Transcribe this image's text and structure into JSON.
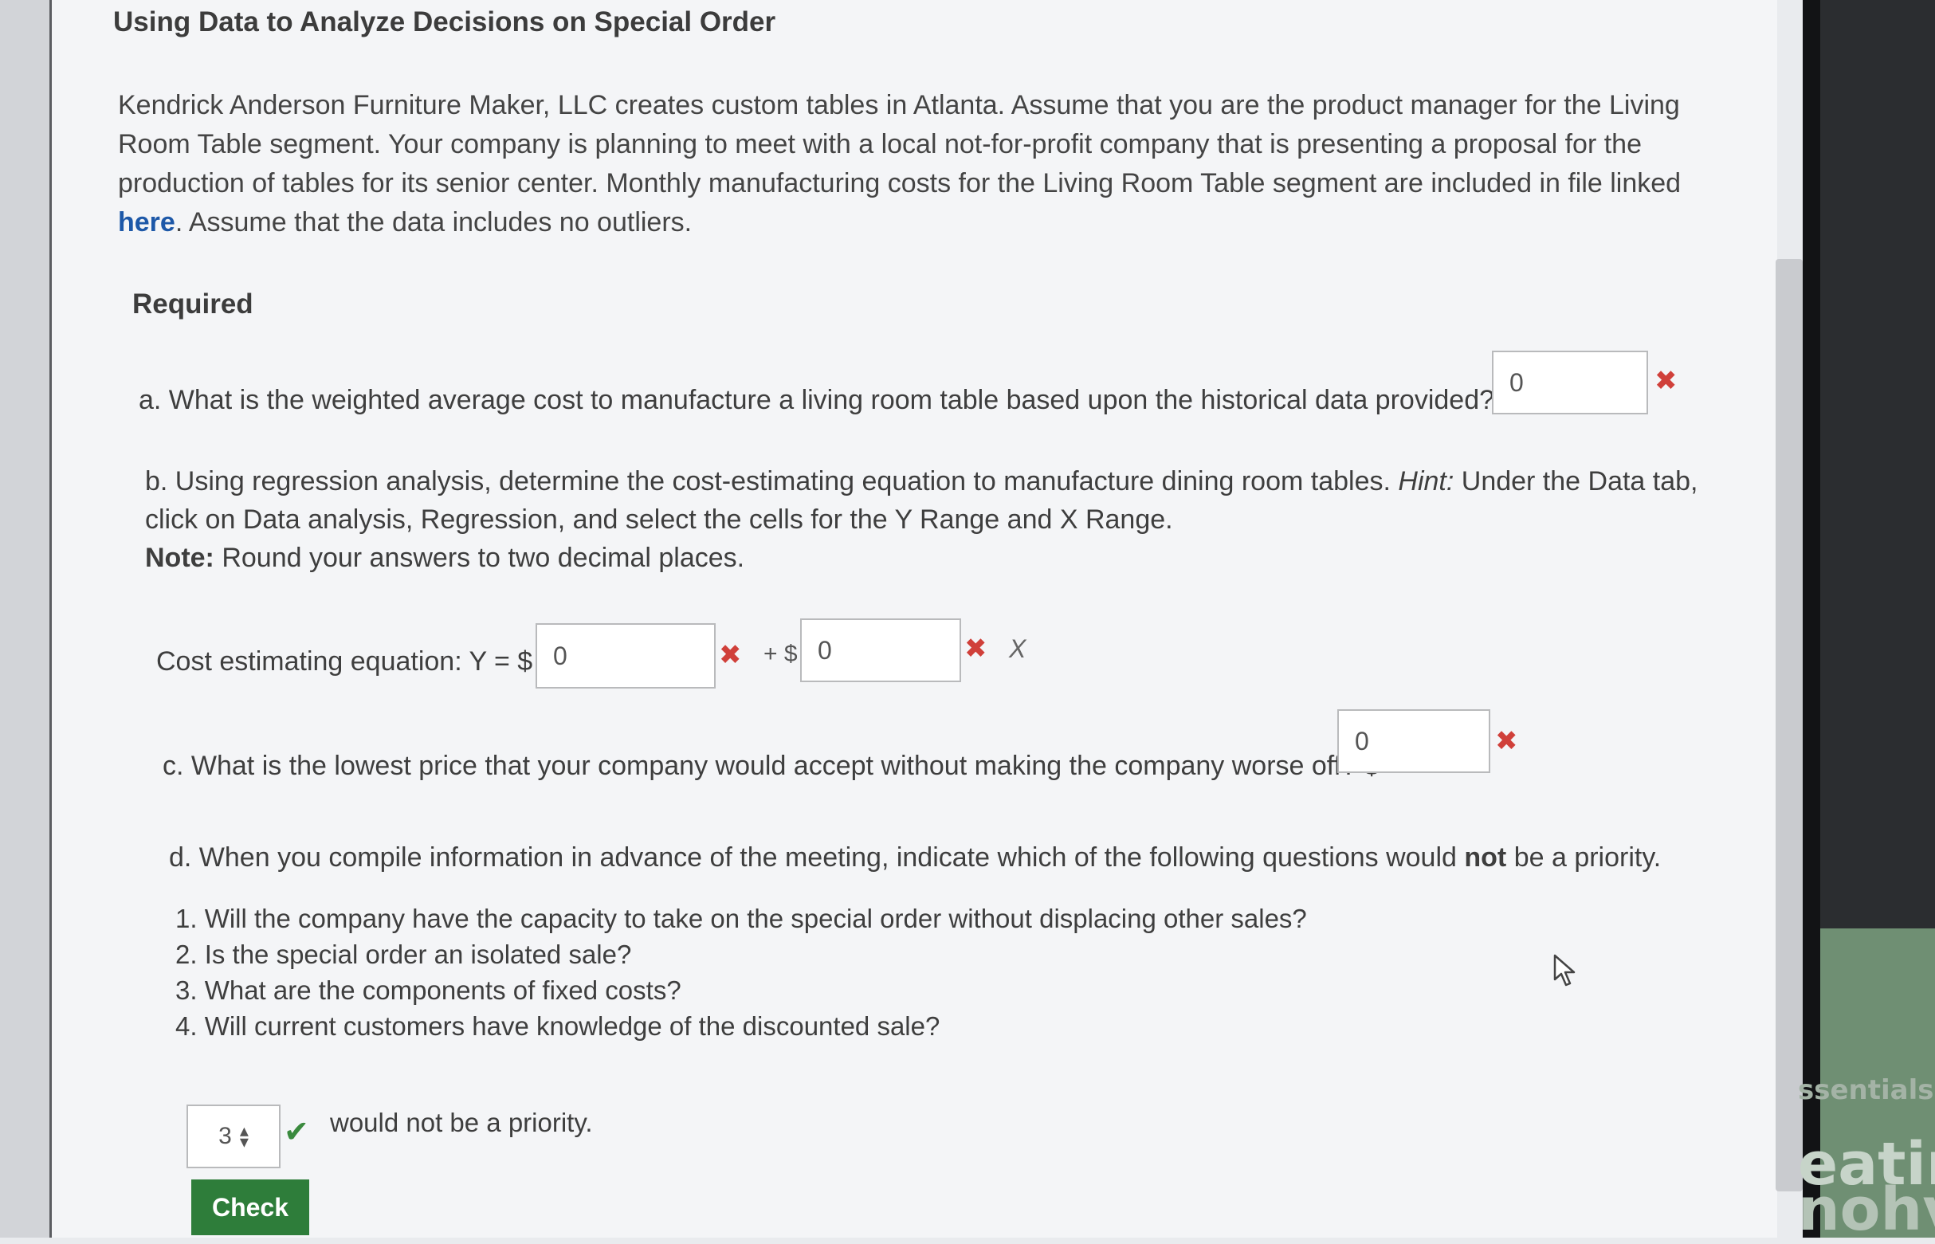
{
  "title": "Using Data to Analyze Decisions on Special Order",
  "intro": {
    "text_before_link": "Kendrick Anderson Furniture Maker, LLC creates custom tables in Atlanta. Assume that you are the product manager for the Living Room Table segment. Your company is planning to meet with a local not-for-profit company that is presenting a proposal for the production of tables for its senior center. Monthly manufacturing costs for the Living Room Table segment are included in file linked ",
    "link_text": "here",
    "text_after_link": ". Assume that the data includes no outliers."
  },
  "required_label": "Required",
  "question_a": {
    "text": "a. What is the weighted average cost to manufacture a living room table based upon the historical data provided? $",
    "value": "0"
  },
  "question_b": {
    "text_before_hint": "b. Using regression analysis, determine the cost-estimating equation to manufacture dining room tables. ",
    "hint_label": "Hint:",
    "text_after_hint": " Under the Data tab, click on Data analysis, Regression, and select the cells for the Y Range and X Range.",
    "note_label": "Note:",
    "note_text": " Round your answers to two decimal places.",
    "equation_label": "Cost estimating equation: Y = $",
    "intercept_value": "0",
    "plus_label": "+ $",
    "slope_value": "0",
    "variable": "X"
  },
  "question_c": {
    "text": "c. What is the lowest price that your company would accept without making the company worse off? $",
    "value": "0"
  },
  "question_d": {
    "text_before_bold": "d. When you compile information in advance of the meeting, indicate which of the following questions would ",
    "bold_text": "not",
    "text_after_bold": " be a priority.",
    "options": [
      "1. Will the company have the capacity to take on the special order without displacing other sales?",
      "2. Is the special order an isolated sale?",
      "3. What are the components of fixed costs?",
      "4. Will current customers have knowledge of the discounted sale?"
    ],
    "selected_value": "3",
    "suffix": "would not be a priority."
  },
  "check_button_label": "Check",
  "background_text": [
    "ssentials",
    "eatin",
    "nohv"
  ],
  "icons": {
    "wrong": "x-icon",
    "correct": "checkmark-icon",
    "cursor": "mouse-pointer-icon",
    "select_arrows": "up-down-arrows-icon"
  },
  "colors": {
    "link": "#1d58a8",
    "wrong": "#d0403a",
    "correct": "#3a8a3e",
    "button": "#2e7d3a"
  }
}
